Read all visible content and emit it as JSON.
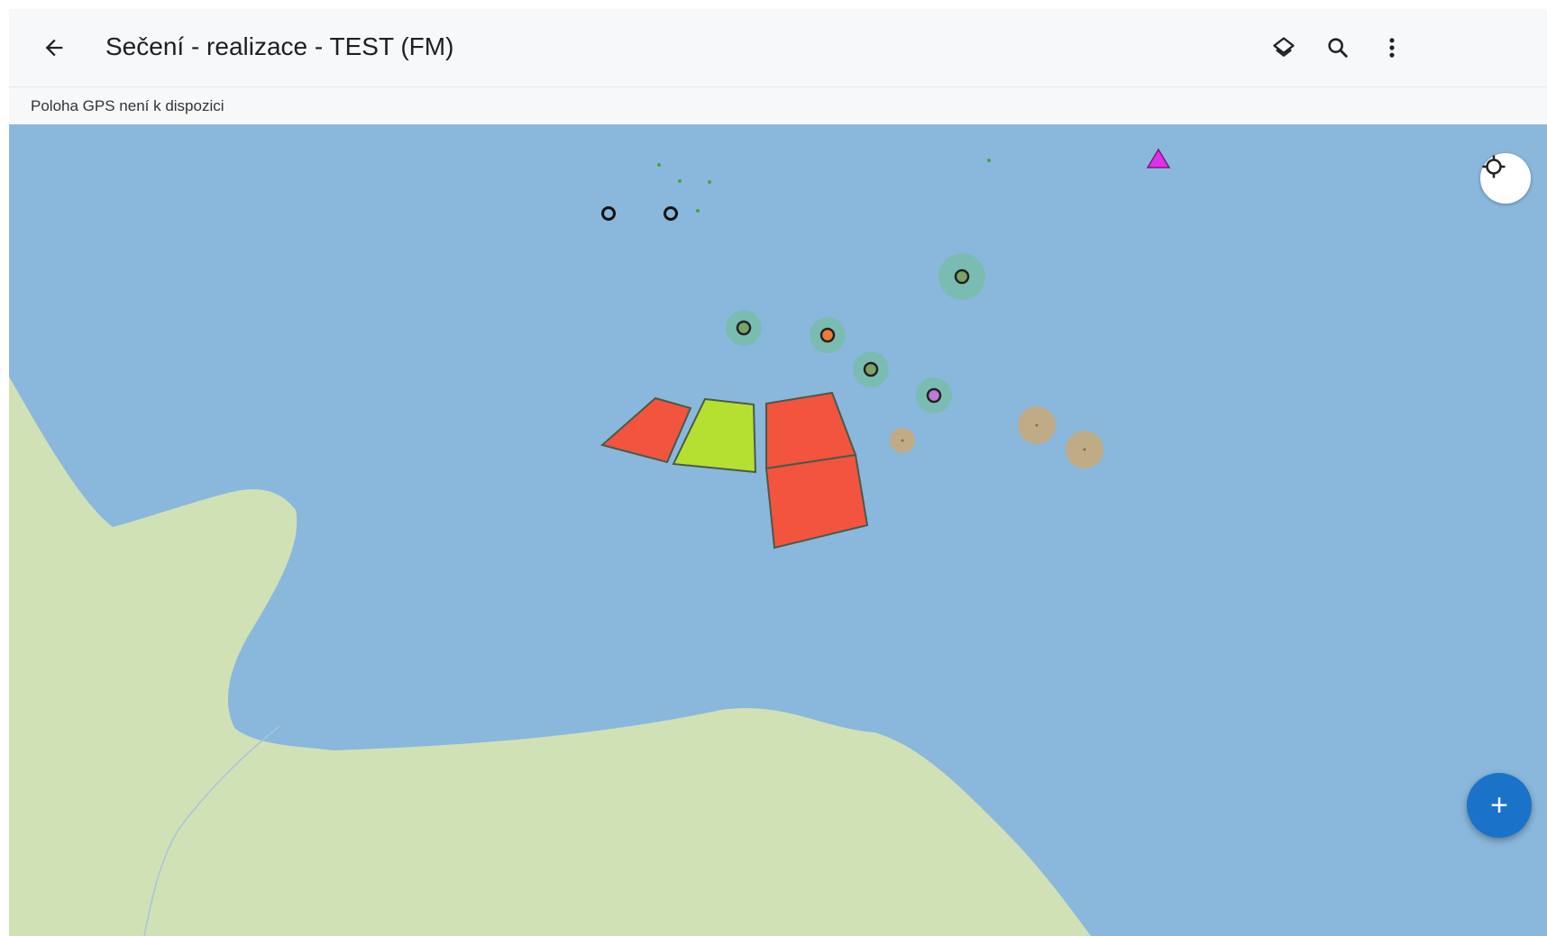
{
  "appbar": {
    "title": "Sečení - realizace - TEST (FM)",
    "back_icon": "arrow-back-icon",
    "actions": [
      {
        "name": "layers-button",
        "icon": "layers-icon"
      },
      {
        "name": "search-button",
        "icon": "search-icon"
      },
      {
        "name": "more-button",
        "icon": "more-vert-icon"
      }
    ]
  },
  "status": {
    "gps_text": "Poloha GPS není k dispozici"
  },
  "map": {
    "colors": {
      "water": "#8ab8dc",
      "land": "#d1e1b6",
      "feature_red": "#f2543d",
      "feature_green": "#b5e032",
      "feature_outline": "#4a5a4a",
      "triangle": "#e030e8",
      "buffer_green": "#6fc08f",
      "buffer_tan": "#c9a878"
    },
    "feature_types": [
      "polygon",
      "point",
      "triangle-marker"
    ],
    "controls": {
      "locate_icon": "my-location-icon",
      "add_icon": "plus-icon",
      "add_label": "+"
    }
  }
}
